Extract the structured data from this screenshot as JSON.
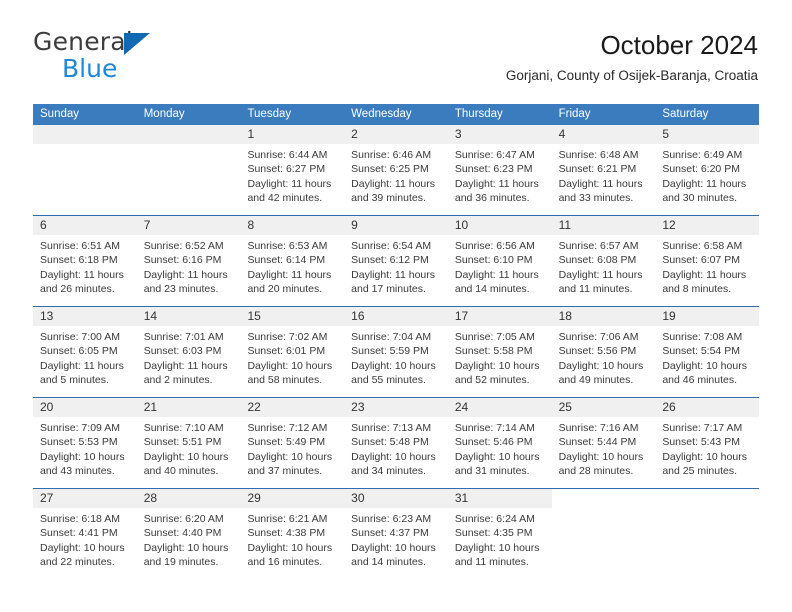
{
  "brand": {
    "name_top": "General",
    "name_bottom": "Blue",
    "triangle_color": "#1268b3",
    "blue_color": "#1e87d6"
  },
  "header": {
    "title": "October 2024",
    "subtitle": "Gorjani, County of Osijek-Baranja, Croatia"
  },
  "theme": {
    "header_blue": "#3a7cbe",
    "row_divider_blue": "#2f6fad",
    "daynum_band": "#f0f0f0"
  },
  "weekdays": [
    "Sunday",
    "Monday",
    "Tuesday",
    "Wednesday",
    "Thursday",
    "Friday",
    "Saturday"
  ],
  "weeks": [
    [
      {
        "day": "",
        "type": "blank"
      },
      {
        "day": "",
        "type": "blank"
      },
      {
        "day": "1",
        "sunrise": "Sunrise: 6:44 AM",
        "sunset": "Sunset: 6:27 PM",
        "daylight1": "Daylight: 11 hours",
        "daylight2": "and 42 minutes."
      },
      {
        "day": "2",
        "sunrise": "Sunrise: 6:46 AM",
        "sunset": "Sunset: 6:25 PM",
        "daylight1": "Daylight: 11 hours",
        "daylight2": "and 39 minutes."
      },
      {
        "day": "3",
        "sunrise": "Sunrise: 6:47 AM",
        "sunset": "Sunset: 6:23 PM",
        "daylight1": "Daylight: 11 hours",
        "daylight2": "and 36 minutes."
      },
      {
        "day": "4",
        "sunrise": "Sunrise: 6:48 AM",
        "sunset": "Sunset: 6:21 PM",
        "daylight1": "Daylight: 11 hours",
        "daylight2": "and 33 minutes."
      },
      {
        "day": "5",
        "sunrise": "Sunrise: 6:49 AM",
        "sunset": "Sunset: 6:20 PM",
        "daylight1": "Daylight: 11 hours",
        "daylight2": "and 30 minutes."
      }
    ],
    [
      {
        "day": "6",
        "sunrise": "Sunrise: 6:51 AM",
        "sunset": "Sunset: 6:18 PM",
        "daylight1": "Daylight: 11 hours",
        "daylight2": "and 26 minutes."
      },
      {
        "day": "7",
        "sunrise": "Sunrise: 6:52 AM",
        "sunset": "Sunset: 6:16 PM",
        "daylight1": "Daylight: 11 hours",
        "daylight2": "and 23 minutes."
      },
      {
        "day": "8",
        "sunrise": "Sunrise: 6:53 AM",
        "sunset": "Sunset: 6:14 PM",
        "daylight1": "Daylight: 11 hours",
        "daylight2": "and 20 minutes."
      },
      {
        "day": "9",
        "sunrise": "Sunrise: 6:54 AM",
        "sunset": "Sunset: 6:12 PM",
        "daylight1": "Daylight: 11 hours",
        "daylight2": "and 17 minutes."
      },
      {
        "day": "10",
        "sunrise": "Sunrise: 6:56 AM",
        "sunset": "Sunset: 6:10 PM",
        "daylight1": "Daylight: 11 hours",
        "daylight2": "and 14 minutes."
      },
      {
        "day": "11",
        "sunrise": "Sunrise: 6:57 AM",
        "sunset": "Sunset: 6:08 PM",
        "daylight1": "Daylight: 11 hours",
        "daylight2": "and 11 minutes."
      },
      {
        "day": "12",
        "sunrise": "Sunrise: 6:58 AM",
        "sunset": "Sunset: 6:07 PM",
        "daylight1": "Daylight: 11 hours",
        "daylight2": "and 8 minutes."
      }
    ],
    [
      {
        "day": "13",
        "sunrise": "Sunrise: 7:00 AM",
        "sunset": "Sunset: 6:05 PM",
        "daylight1": "Daylight: 11 hours",
        "daylight2": "and 5 minutes."
      },
      {
        "day": "14",
        "sunrise": "Sunrise: 7:01 AM",
        "sunset": "Sunset: 6:03 PM",
        "daylight1": "Daylight: 11 hours",
        "daylight2": "and 2 minutes."
      },
      {
        "day": "15",
        "sunrise": "Sunrise: 7:02 AM",
        "sunset": "Sunset: 6:01 PM",
        "daylight1": "Daylight: 10 hours",
        "daylight2": "and 58 minutes."
      },
      {
        "day": "16",
        "sunrise": "Sunrise: 7:04 AM",
        "sunset": "Sunset: 5:59 PM",
        "daylight1": "Daylight: 10 hours",
        "daylight2": "and 55 minutes."
      },
      {
        "day": "17",
        "sunrise": "Sunrise: 7:05 AM",
        "sunset": "Sunset: 5:58 PM",
        "daylight1": "Daylight: 10 hours",
        "daylight2": "and 52 minutes."
      },
      {
        "day": "18",
        "sunrise": "Sunrise: 7:06 AM",
        "sunset": "Sunset: 5:56 PM",
        "daylight1": "Daylight: 10 hours",
        "daylight2": "and 49 minutes."
      },
      {
        "day": "19",
        "sunrise": "Sunrise: 7:08 AM",
        "sunset": "Sunset: 5:54 PM",
        "daylight1": "Daylight: 10 hours",
        "daylight2": "and 46 minutes."
      }
    ],
    [
      {
        "day": "20",
        "sunrise": "Sunrise: 7:09 AM",
        "sunset": "Sunset: 5:53 PM",
        "daylight1": "Daylight: 10 hours",
        "daylight2": "and 43 minutes."
      },
      {
        "day": "21",
        "sunrise": "Sunrise: 7:10 AM",
        "sunset": "Sunset: 5:51 PM",
        "daylight1": "Daylight: 10 hours",
        "daylight2": "and 40 minutes."
      },
      {
        "day": "22",
        "sunrise": "Sunrise: 7:12 AM",
        "sunset": "Sunset: 5:49 PM",
        "daylight1": "Daylight: 10 hours",
        "daylight2": "and 37 minutes."
      },
      {
        "day": "23",
        "sunrise": "Sunrise: 7:13 AM",
        "sunset": "Sunset: 5:48 PM",
        "daylight1": "Daylight: 10 hours",
        "daylight2": "and 34 minutes."
      },
      {
        "day": "24",
        "sunrise": "Sunrise: 7:14 AM",
        "sunset": "Sunset: 5:46 PM",
        "daylight1": "Daylight: 10 hours",
        "daylight2": "and 31 minutes."
      },
      {
        "day": "25",
        "sunrise": "Sunrise: 7:16 AM",
        "sunset": "Sunset: 5:44 PM",
        "daylight1": "Daylight: 10 hours",
        "daylight2": "and 28 minutes."
      },
      {
        "day": "26",
        "sunrise": "Sunrise: 7:17 AM",
        "sunset": "Sunset: 5:43 PM",
        "daylight1": "Daylight: 10 hours",
        "daylight2": "and 25 minutes."
      }
    ],
    [
      {
        "day": "27",
        "sunrise": "Sunrise: 6:18 AM",
        "sunset": "Sunset: 4:41 PM",
        "daylight1": "Daylight: 10 hours",
        "daylight2": "and 22 minutes."
      },
      {
        "day": "28",
        "sunrise": "Sunrise: 6:20 AM",
        "sunset": "Sunset: 4:40 PM",
        "daylight1": "Daylight: 10 hours",
        "daylight2": "and 19 minutes."
      },
      {
        "day": "29",
        "sunrise": "Sunrise: 6:21 AM",
        "sunset": "Sunset: 4:38 PM",
        "daylight1": "Daylight: 10 hours",
        "daylight2": "and 16 minutes."
      },
      {
        "day": "30",
        "sunrise": "Sunrise: 6:23 AM",
        "sunset": "Sunset: 4:37 PM",
        "daylight1": "Daylight: 10 hours",
        "daylight2": "and 14 minutes."
      },
      {
        "day": "31",
        "sunrise": "Sunrise: 6:24 AM",
        "sunset": "Sunset: 4:35 PM",
        "daylight1": "Daylight: 10 hours",
        "daylight2": "and 11 minutes."
      },
      {
        "day": "",
        "type": "empty"
      },
      {
        "day": "",
        "type": "empty"
      }
    ]
  ]
}
